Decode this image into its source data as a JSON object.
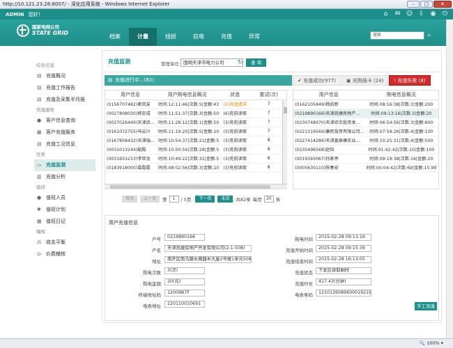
{
  "window": {
    "title": "http://10.121.23.28:8007/ - 深化应用系统 - Windows Internet Explorer"
  },
  "topbar": {
    "user": "ADMIN",
    "greeting": "您好！"
  },
  "logo": {
    "cn": "国家电网公司",
    "en": "STATE GRID"
  },
  "nav": [
    "档案",
    "计量",
    "线损",
    "窃电",
    "充值",
    "异常"
  ],
  "nav_active": "计量",
  "search": {
    "placeholder": "搜索"
  },
  "sidebar": [
    {
      "group": "综合信息",
      "items": [
        "充值概况",
        "充值工作报告",
        "充值及采集半月报"
      ]
    },
    {
      "group": "充值服务",
      "items": [
        "客户信息查询",
        "客户充值服务",
        "充值工况信息"
      ]
    },
    {
      "group": "任务",
      "items": [
        "充值监测",
        "充值分析"
      ]
    },
    {
      "group": "值班",
      "items": [
        "值班人员",
        "值班计划",
        "值班日记"
      ]
    },
    {
      "group": "稽核",
      "items": [
        "收支平衡",
        "价费稽核"
      ]
    }
  ],
  "sidebar_active": "充值监测",
  "page": {
    "title": "充值监测",
    "unit_label": "管理单位",
    "unit_value": "国网天津市电力公司",
    "query_btn": "查 询"
  },
  "tabs": {
    "left": "充值进行中...(82)",
    "success": "充值成功(977)",
    "card": "充购插卡 (24)",
    "fail": "充值失败 (8)"
  },
  "left_table": {
    "headers": [
      "用户信息",
      "用户购电信息概况",
      "状态",
      "重试(次)"
    ],
    "rows": [
      [
        "(0156707482)崔凤友",
        "时间:12:11:46|次数:5|金额:43",
        "(5)充值请求",
        "7"
      ],
      [
        "(0027808030)郭忠成",
        "时间:11:51:37|次数:3|金额:50",
        "(6)充前读取",
        "7"
      ],
      [
        "(0027026449)天津凯...",
        "时间:11:28:12|次数:1|金额:50",
        "(3)充前读取",
        "7"
      ],
      [
        "(0161072755)马云兴",
        "时间:11:19:20|次数:5|金额:10",
        "(3)充前读取",
        "7"
      ],
      [
        "(0167858432)天津瑞...",
        "时间:10:54:37|次数:21|金额:5",
        "(3)充前读取",
        "8"
      ],
      [
        "(0031013244)配殿",
        "时间:10:50:54|次数:28|金额:5",
        "(3)充前读取",
        "8"
      ],
      [
        "(0031653233)李世龙",
        "时间:10:49:22|次数:31|金额:5",
        "(3)充前读取",
        "8"
      ],
      [
        "(0183918000)葛磊磊",
        "时间:08:02:56|次数:3|金额:10",
        "(3)充前读取",
        "8"
      ]
    ]
  },
  "right_table": {
    "headers": [
      "用户信息",
      "购电信息概况"
    ],
    "rows": [
      [
        "(0162105849)杨伯新",
        "时间:08:16:38|次数:3|金额:200"
      ],
      [
        "(0219890166)天津凯捷房地产...",
        "时间:09:13:16|次数:3|金额:20"
      ],
      [
        "(0230748970)天津综合投资发...",
        "时间:06:54:56|次数:3|金额:600"
      ],
      [
        "(0221319569)康民投资有限公司...",
        "时间:07:59:26|次数:4|金额:100"
      ],
      [
        "(0227414286)天津鑫泰康实业...",
        "时间:10:25:31|次数:4|金额:500"
      ],
      [
        "(0235496568)赵怡",
        "时间:01:42:42|次数:10|金额:100"
      ],
      [
        "(0019393067)孙家亭",
        "时间:09:19:38|次数:16|金额:20"
      ],
      [
        "(0005630110)陈春宏",
        "时间:00:04:42|次数:69|金额:15.99"
      ]
    ]
  },
  "pager": {
    "first": "首页",
    "prev": "上一页",
    "page_label": "第",
    "page": "1",
    "total": "/ 5页",
    "next": "下一页",
    "last": "末页",
    "count": "共82条",
    "per_label": "每页",
    "per": "20",
    "unit": "条"
  },
  "detail": {
    "title": "用户充值信息",
    "left": [
      {
        "label": "户号",
        "value": "0219890166"
      },
      {
        "label": "户名",
        "value": "天津凯捷房地产开发有限公司(2-1-508)"
      },
      {
        "label": "地址",
        "value": "南开区南马路水阁器半大厦2号楼1单元508"
      },
      {
        "label": "购电次数",
        "value": "3(次)"
      },
      {
        "label": "购电金额",
        "value": "20(元)"
      },
      {
        "label": "终端地址码",
        "value": "12009B7F"
      },
      {
        "label": "电表地址",
        "value": "120110010691"
      }
    ],
    "right": [
      {
        "label": "购电时间",
        "value": "2015-02-28 09:13:16"
      },
      {
        "label": "充值开始时间",
        "value": "2015-02-28 09:15:39"
      },
      {
        "label": "充值结束时间",
        "value": "2015-02-28 16:13:05"
      },
      {
        "label": "充值状态",
        "value": "下发后读取剩时"
      },
      {
        "label": "充值时长",
        "value": "417.43(分钟)"
      },
      {
        "label": "电表条码",
        "value": "121012608960001921932"
      }
    ],
    "manual_btn": "手工充值"
  },
  "status": {
    "zoom": "100%"
  },
  "colors": {
    "brand": "#1d8f8b",
    "fail": "#d32b2b",
    "pending": "#e58c00"
  }
}
